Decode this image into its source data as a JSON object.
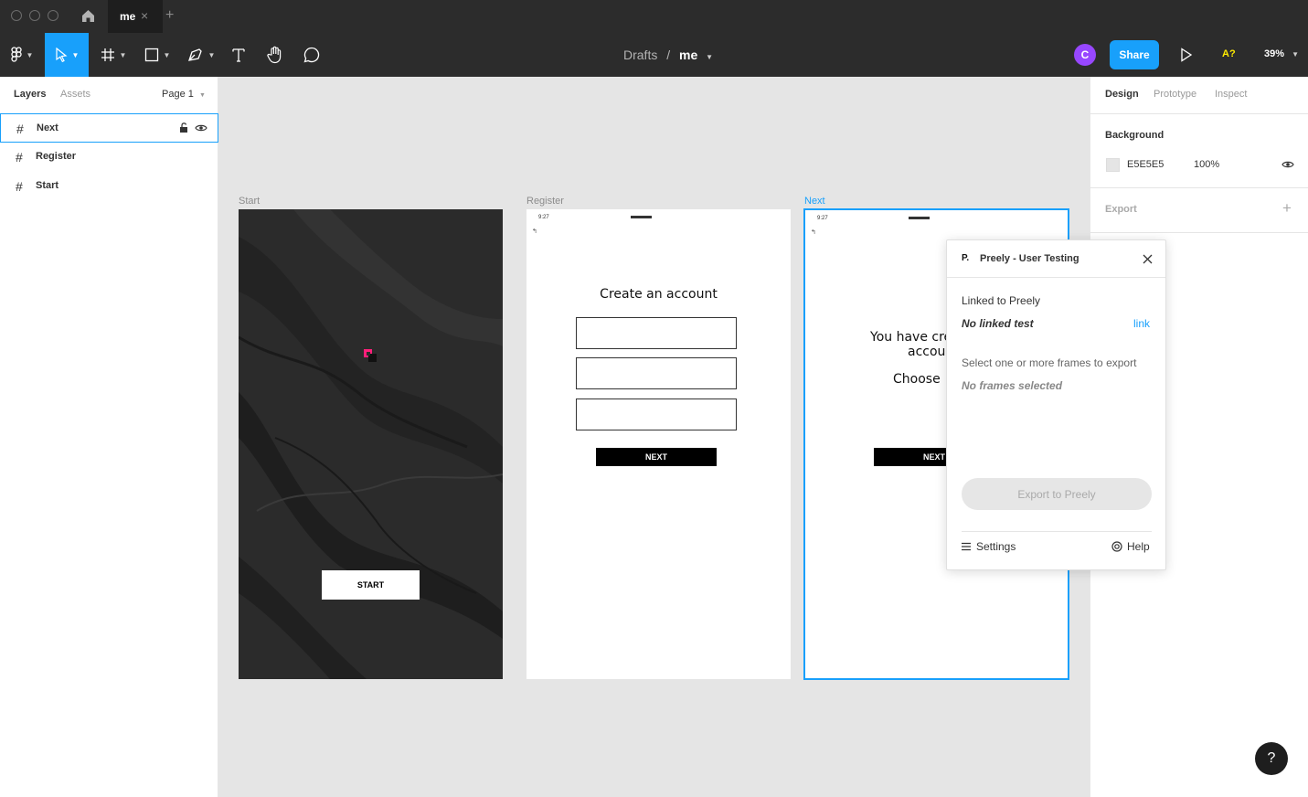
{
  "tabbar": {
    "tab_title": "me",
    "tab_close": "×",
    "add": "+"
  },
  "toolbar": {
    "breadcrumb_folder": "Drafts",
    "breadcrumb_sep": "/",
    "file_name": "me",
    "avatar_initial": "C",
    "share_label": "Share",
    "a11y_label": "A?",
    "zoom_level": "39%"
  },
  "left": {
    "tabs": {
      "layers": "Layers",
      "assets": "Assets"
    },
    "page": "Page 1",
    "layers": [
      {
        "name": "Next"
      },
      {
        "name": "Register"
      },
      {
        "name": "Start"
      }
    ]
  },
  "canvas": {
    "frames": {
      "start": {
        "label": "Start",
        "button": "START"
      },
      "register": {
        "label": "Register",
        "time": "9:27",
        "heading": "Create an account",
        "button": "NEXT"
      },
      "next": {
        "label": "Next",
        "time": "9:27",
        "line1": "You have cre",
        "line2": "accou",
        "line3": "Choose",
        "button": "NEXT"
      }
    }
  },
  "right": {
    "tabs": {
      "design": "Design",
      "prototype": "Prototype",
      "inspect": "Inspect"
    },
    "background_title": "Background",
    "background_hex": "E5E5E5",
    "background_opacity": "100%",
    "export_title": "Export",
    "export_add": "+"
  },
  "plugin": {
    "logo": "P.",
    "title": "Preely - User Testing",
    "linked_label": "Linked to Preely",
    "linked_value": "No linked test",
    "link": "link",
    "select_label": "Select one or more frames to export",
    "select_value": "No frames selected",
    "export_button": "Export to Preely",
    "settings": "Settings",
    "help": "Help"
  },
  "help_fab": "?",
  "colors": {
    "accent": "#18a0fb",
    "avatar": "#9747ff",
    "a11y": "#ffeb00",
    "toolbar": "#2c2c2c",
    "canvas": "#e5e5e5"
  }
}
